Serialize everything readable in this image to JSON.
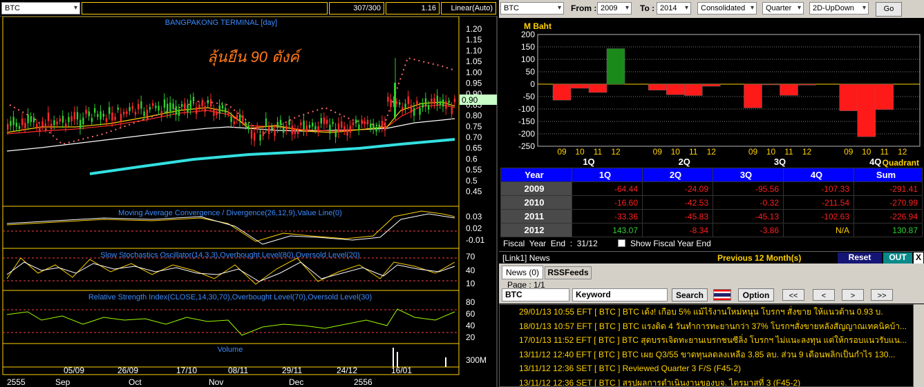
{
  "chart_toolbar": {
    "symbol": "BTC",
    "count": "307/300",
    "scale": "1.16",
    "mode": "Linear(Auto)"
  },
  "left": {
    "price_title": "BANGPAKONG TERMINAL [day]",
    "annotation": "ลุ้นยืน 90 ตังค์",
    "price_ticks": [
      "1.20",
      "1.15",
      "1.10",
      "1.05",
      "1.00",
      "0.95",
      "0.90",
      "0.85",
      "0.80",
      "0.75",
      "0.70",
      "0.65",
      "0.6",
      "0.55",
      "0.5",
      "0.45"
    ],
    "last_price": "0.90",
    "macd_title": "Moving Average Convergence / Divergence(26,12,9),Value Line(0)",
    "macd_ticks": [
      "0.03",
      "0.02",
      "-0.01"
    ],
    "stoch_title": "Slow Stochastics Oscillator(14,3,3),Overbought Level(80),Oversold Level(20)",
    "stoch_ticks": [
      "70",
      "40",
      "10"
    ],
    "rsi_title": "Relative Strength Index(CLOSE,14,30,70),Overbought Level(70),Oversold Level(30)",
    "rsi_ticks": [
      "80",
      "60",
      "40",
      "20"
    ],
    "volume_title": "Volume",
    "volume_tick": "300M",
    "dates": [
      "05/09",
      "26/09",
      "17/10",
      "08/11",
      "29/11",
      "24/12",
      "16/01"
    ],
    "months": [
      "2555",
      "Sep",
      "Oct",
      "Nov",
      "Dec",
      "2556"
    ]
  },
  "right_toolbar": {
    "symbol": "BTC",
    "from_label": "From :",
    "from": "2009",
    "to_label": "To :",
    "to": "2014",
    "statement": "Consolidated",
    "period": "Quarter",
    "view": "2D-UpDown",
    "go": "Go"
  },
  "colors": {
    "positive": "#2fd12f",
    "negative": "#ff2020",
    "accent": "#ffd200",
    "header_blue": "#0000ff"
  },
  "chart_data": {
    "type": "bar",
    "ylabel": "M Baht",
    "xlabel": "Quadrant",
    "ylim": [
      -250,
      200
    ],
    "yticks": [
      200,
      150,
      100,
      50,
      0,
      -50,
      -100,
      -150,
      -200,
      -250
    ],
    "groups": [
      "1Q",
      "2Q",
      "3Q",
      "4Q"
    ],
    "years": [
      "09",
      "10",
      "11",
      "12"
    ],
    "series": [
      {
        "name": "1Q",
        "values": [
          -64.44,
          -16.6,
          -33.36,
          143.07
        ]
      },
      {
        "name": "2Q",
        "values": [
          -24.09,
          -42.53,
          -45.83,
          -8.34
        ]
      },
      {
        "name": "3Q",
        "values": [
          -95.56,
          -0.32,
          -45.13,
          -3.86
        ]
      },
      {
        "name": "4Q",
        "values": [
          -107.33,
          -211.54,
          -102.63,
          null
        ]
      }
    ]
  },
  "fin_table": {
    "headers": [
      "Year",
      "1Q",
      "2Q",
      "3Q",
      "4Q",
      "Sum"
    ],
    "rows": [
      {
        "year": "2009",
        "cells": [
          "-64.44",
          "-24.09",
          "-95.56",
          "-107.33",
          "-291.41"
        ],
        "cls": [
          "neg",
          "neg",
          "neg",
          "neg",
          "neg"
        ]
      },
      {
        "year": "2010",
        "cells": [
          "-16.60",
          "-42.53",
          "-0.32",
          "-211.54",
          "-270.99"
        ],
        "cls": [
          "neg",
          "neg",
          "neg",
          "neg",
          "neg"
        ]
      },
      {
        "year": "2011",
        "cells": [
          "-33.36",
          "-45.83",
          "-45.13",
          "-102.63",
          "-226.94"
        ],
        "cls": [
          "neg",
          "neg",
          "neg",
          "neg",
          "neg"
        ]
      },
      {
        "year": "2012",
        "cells": [
          "143.07",
          "-8.34",
          "-3.86",
          "N/A",
          "130.87"
        ],
        "cls": [
          "pos",
          "neg",
          "neg",
          "na",
          "pos"
        ]
      }
    ],
    "fiscal": "Fiscal  Year  End  :  31/12",
    "show_fy": "Show Fiscal Year End"
  },
  "news_panel": {
    "link": "[Link1] News",
    "previous": "Previous 12 Month(s)",
    "reset": "Reset",
    "out": "OUT",
    "close": "X",
    "tab_news": "News (0)",
    "tab_rss": "RSSFeeds",
    "page": "Page : 1/1",
    "symbol": "BTC",
    "keyword": "Keyword",
    "search": "Search",
    "option": "Option",
    "nav": [
      "<<",
      "<",
      ">",
      ">>"
    ],
    "items": [
      "29/01/13 10:55  EFT  [ BTC ]  BTC เด้ง! เกือบ 5% แม้ไร้งานใหม่หนุน โบรกฯ สั่งขาย ให้แนวต้าน 0.93 บ.",
      "18/01/13 10:57  EFT  [ BTC ]  BTC แรงติด 4 วันทำการทะยานกว่า 37% โบรกฯสั่งขายหลังสัญญาณเทคนิคบ้า...",
      "17/01/13 11:52  EFT  [ BTC ]  BTC สุดบรรเจิดทะยานเบรกชนซีลิ่ง โบรกฯ ไม่แนะลงทุน แต่ให้กรอบแนวรับแน...",
      "13/11/12 12:40  EFT  [ BTC ]  BTC เผย Q3/55 ขาดทุนลดลงเหลือ 3.85 ลบ. ส่วน 9 เดือนพลิกเป็นกำไร 130...",
      "13/11/12 12:36  SET  [ BTC ]  Reviewed Quarter 3 F/S (F45-2)",
      "13/11/12 12:36  SET  [ BTC ]  สรุปผลการดำเนินงานของบจ. ไตรมาสที่ 3 (F45-2)"
    ]
  }
}
